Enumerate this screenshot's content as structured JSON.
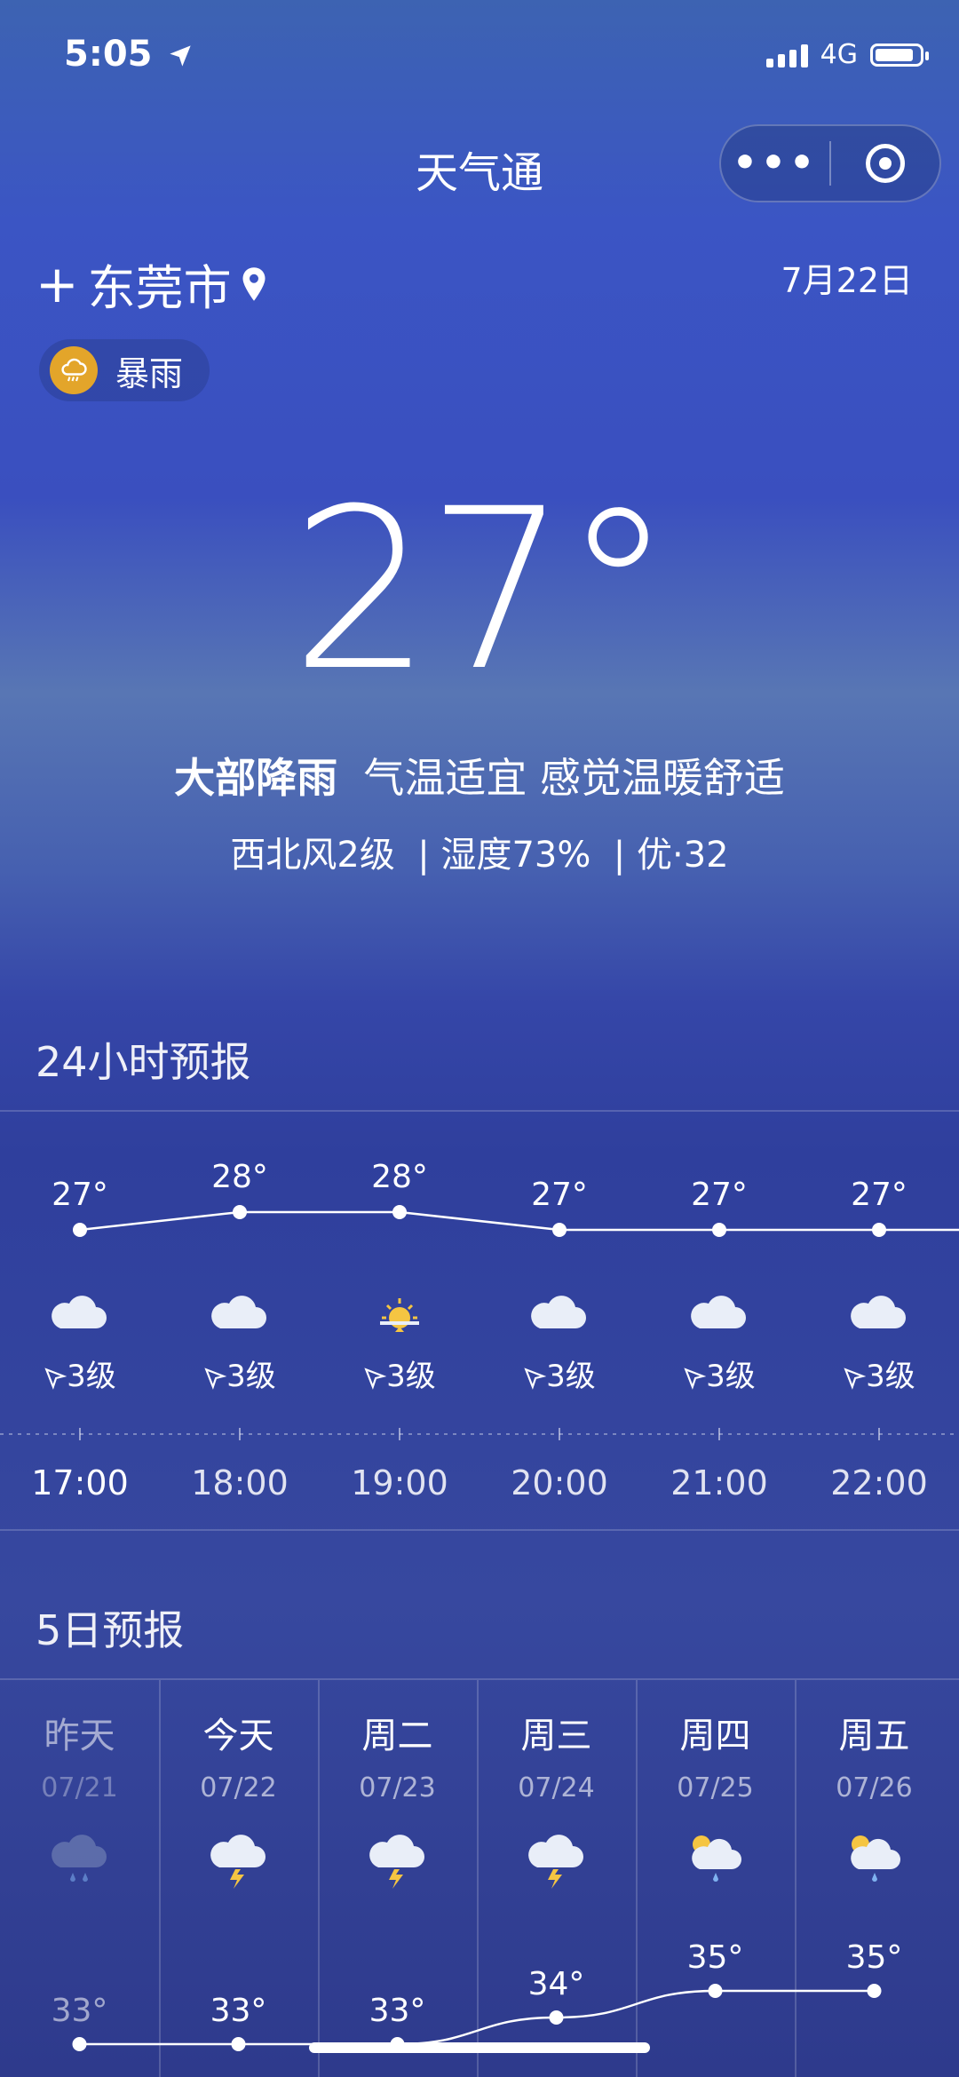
{
  "status_bar": {
    "time": "5:05",
    "network": "4G",
    "icons": [
      "location-arrow-icon",
      "signal-icon",
      "battery-icon"
    ]
  },
  "nav": {
    "title": "天气通",
    "more_icon": "more-dots-icon",
    "close_icon": "close-circle-icon"
  },
  "location": {
    "city": "东莞市",
    "add_icon": "plus-icon",
    "pin_icon": "location-pin-icon",
    "date": "7月22日"
  },
  "alert": {
    "label": "暴雨",
    "icon": "rainstorm-icon",
    "color": "#e3a52a"
  },
  "current": {
    "temperature": "27°",
    "condition": "大部降雨",
    "comfort": "气温适宜 感觉温暖舒适",
    "wind": "西北风2级",
    "humidity": "湿度73%",
    "aqi": "优·32"
  },
  "hourly": {
    "title": "24小时预报",
    "items": [
      {
        "temp": "27°",
        "temp_value": 27,
        "icon": "cloudy-icon",
        "wind": "3级",
        "time": "17:00"
      },
      {
        "temp": "28°",
        "temp_value": 28,
        "icon": "cloudy-icon",
        "wind": "3级",
        "time": "18:00"
      },
      {
        "temp": "28°",
        "temp_value": 28,
        "icon": "sunset-icon",
        "wind": "3级",
        "time": "19:00"
      },
      {
        "temp": "27°",
        "temp_value": 27,
        "icon": "cloudy-icon",
        "wind": "3级",
        "time": "20:00"
      },
      {
        "temp": "27°",
        "temp_value": 27,
        "icon": "cloudy-icon",
        "wind": "3级",
        "time": "21:00"
      },
      {
        "temp": "27°",
        "temp_value": 27,
        "icon": "cloudy-icon",
        "wind": "3级",
        "time": "22:00"
      }
    ]
  },
  "daily": {
    "title": "5日预报",
    "items": [
      {
        "day": "昨天",
        "date": "07/21",
        "icon": "rain-cloud-icon",
        "max": "33°",
        "max_value": 33,
        "past": true
      },
      {
        "day": "今天",
        "date": "07/22",
        "icon": "thunderstorm-icon",
        "max": "33°",
        "max_value": 33,
        "past": false
      },
      {
        "day": "周二",
        "date": "07/23",
        "icon": "thunderstorm-icon",
        "max": "33°",
        "max_value": 33,
        "past": false
      },
      {
        "day": "周三",
        "date": "07/24",
        "icon": "thunderstorm-icon",
        "max": "34°",
        "max_value": 34,
        "past": false
      },
      {
        "day": "周四",
        "date": "07/25",
        "icon": "sun-rain-icon",
        "max": "35°",
        "max_value": 35,
        "past": false
      },
      {
        "day": "周五",
        "date": "07/26",
        "icon": "sun-rain-icon",
        "max": "35°",
        "max_value": 35,
        "past": false
      }
    ]
  }
}
